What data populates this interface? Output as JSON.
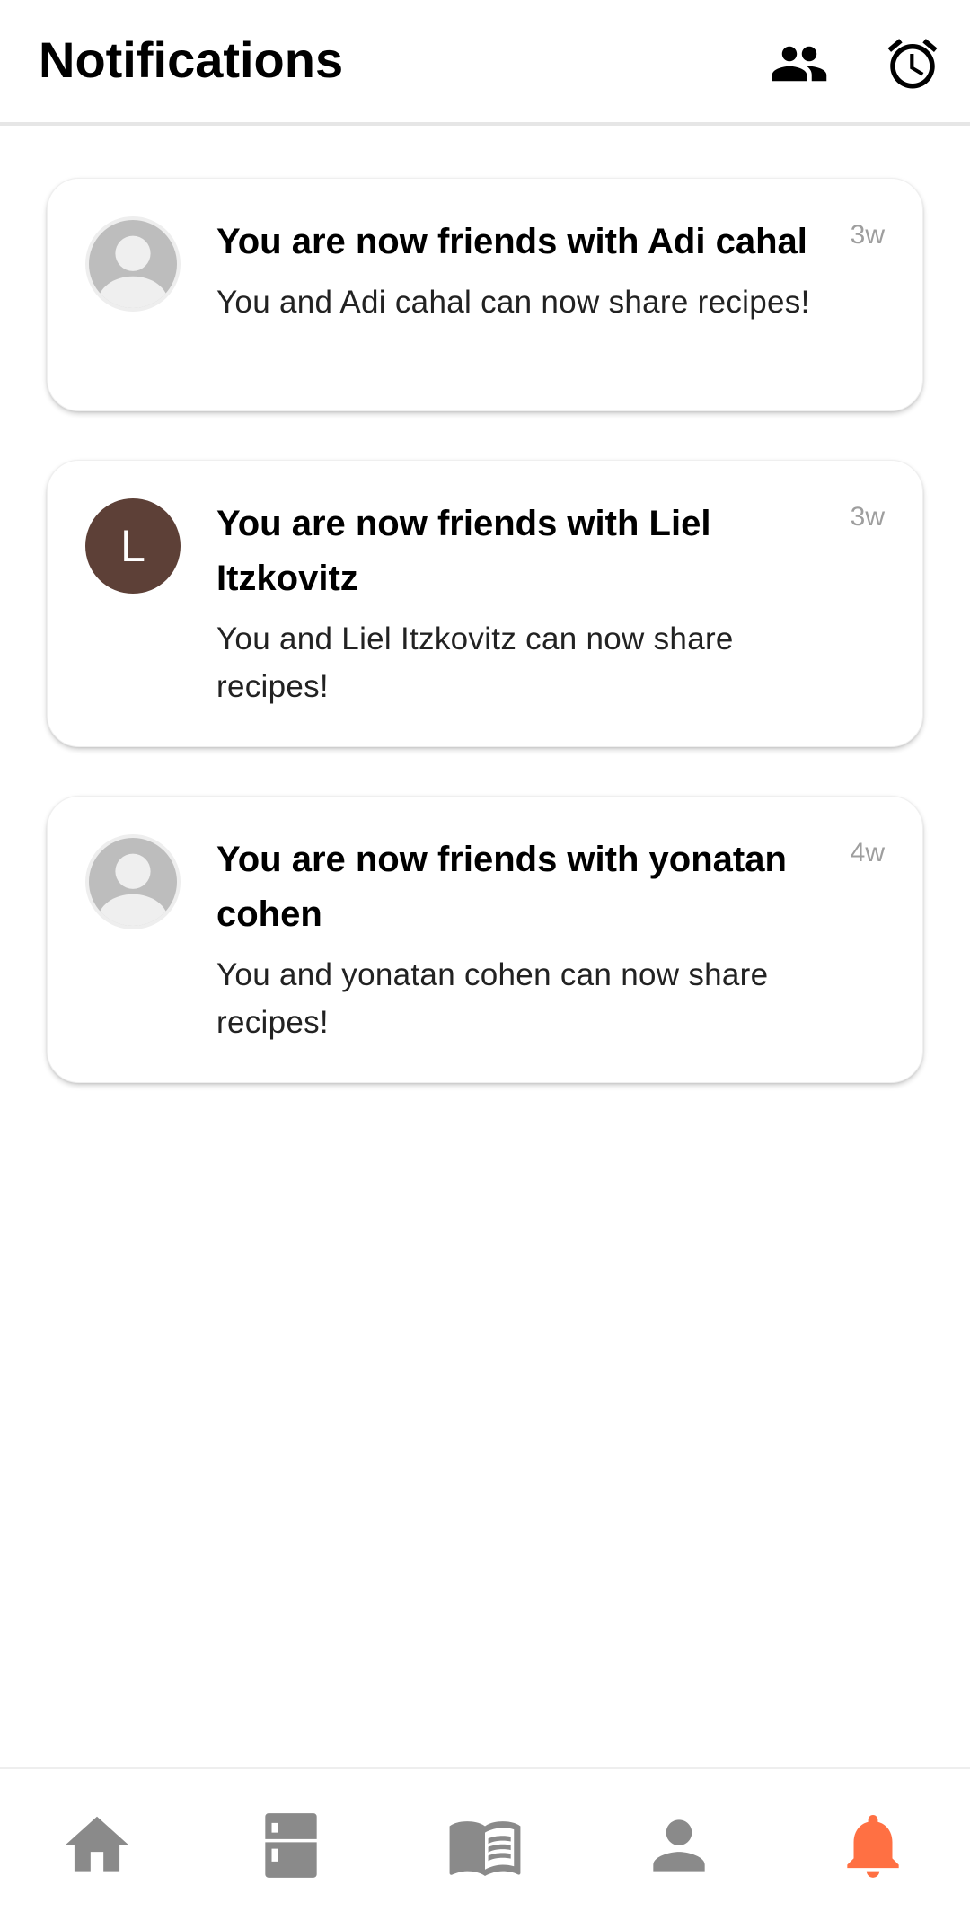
{
  "header": {
    "title": "Notifications",
    "icons": [
      "friends-icon",
      "alarm-clock-icon"
    ]
  },
  "notifications": [
    {
      "avatar": "default-person",
      "title": "You are now friends with Adi cahal",
      "body": "You and Adi cahal can now share recipes!",
      "time": "3w"
    },
    {
      "avatar": "letter",
      "avatar_letter": "L",
      "avatar_color": "#5d4037",
      "title": "You are now friends with Liel Itzkovitz",
      "body": "You and Liel Itzkovitz can now share recipes!",
      "time": "3w"
    },
    {
      "avatar": "default-person",
      "title": "You are now friends with yonatan cohen",
      "body": "You and yonatan cohen can now share recipes!",
      "time": "4w"
    }
  ],
  "bottom_nav": {
    "items": [
      "home-icon",
      "fridge-icon",
      "book-icon",
      "profile-icon",
      "notifications-icon"
    ],
    "active": "notifications-icon",
    "inactive_color": "#8a8a8a",
    "active_color": "#ff7043"
  }
}
